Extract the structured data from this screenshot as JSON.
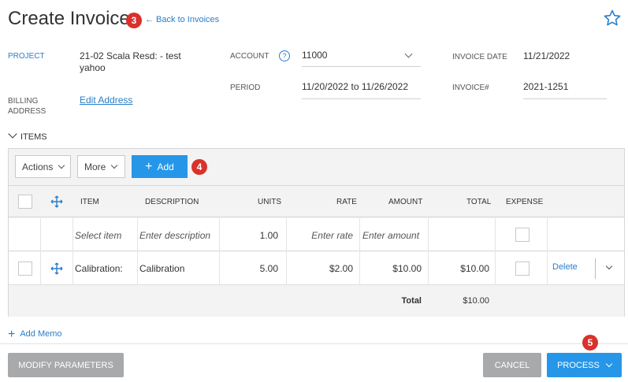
{
  "page": {
    "title": "Create Invoice",
    "back_link": "← Back to Invoices",
    "badges": {
      "b3": "3",
      "b4": "4",
      "b5": "5"
    },
    "star_icon": "star-outline-icon"
  },
  "form": {
    "project_label": "PROJECT",
    "project_value_line1": "21-02 Scala Resd: - test",
    "project_value_line2": "yahoo",
    "billing_label_line1": "BILLING",
    "billing_label_line2": "ADDRESS",
    "edit_address": "Edit Address",
    "account_label": "ACCOUNT",
    "account_help": "?",
    "account_value": "11000",
    "period_label": "PERIOD",
    "period_value": "11/20/2022 to 11/26/2022",
    "invoice_date_label": "INVOICE DATE",
    "invoice_date_value": "11/21/2022",
    "invoice_no_label": "INVOICE#",
    "invoice_no_value": "2021-1251"
  },
  "items": {
    "section_label": "ITEMS",
    "actions_label": "Actions",
    "more_label": "More",
    "add_label": "Add",
    "columns": {
      "item": "ITEM",
      "description": "DESCRIPTION",
      "units": "UNITS",
      "rate": "RATE",
      "amount": "AMOUNT",
      "total": "TOTAL",
      "expense": "EXPENSE"
    },
    "new_row": {
      "item_placeholder": "Select item",
      "description_placeholder": "Enter description",
      "units": "1.00",
      "rate_placeholder": "Enter rate",
      "amount_placeholder": "Enter amount"
    },
    "rows": [
      {
        "item": "Calibration:",
        "description": "Calibration",
        "units": "5.00",
        "rate": "$2.00",
        "amount": "$10.00",
        "total": "$10.00",
        "delete_label": "Delete"
      }
    ],
    "total_label": "Total",
    "total_value": "$10.00"
  },
  "footer": {
    "add_memo": "Add Memo",
    "modify_parameters": "MODIFY PARAMETERS",
    "cancel": "CANCEL",
    "process": "PROCESS"
  },
  "colors": {
    "accent": "#2696e8",
    "link": "#2a7fc8",
    "badge": "#d9312b",
    "button_grey": "#a7a9ab"
  }
}
